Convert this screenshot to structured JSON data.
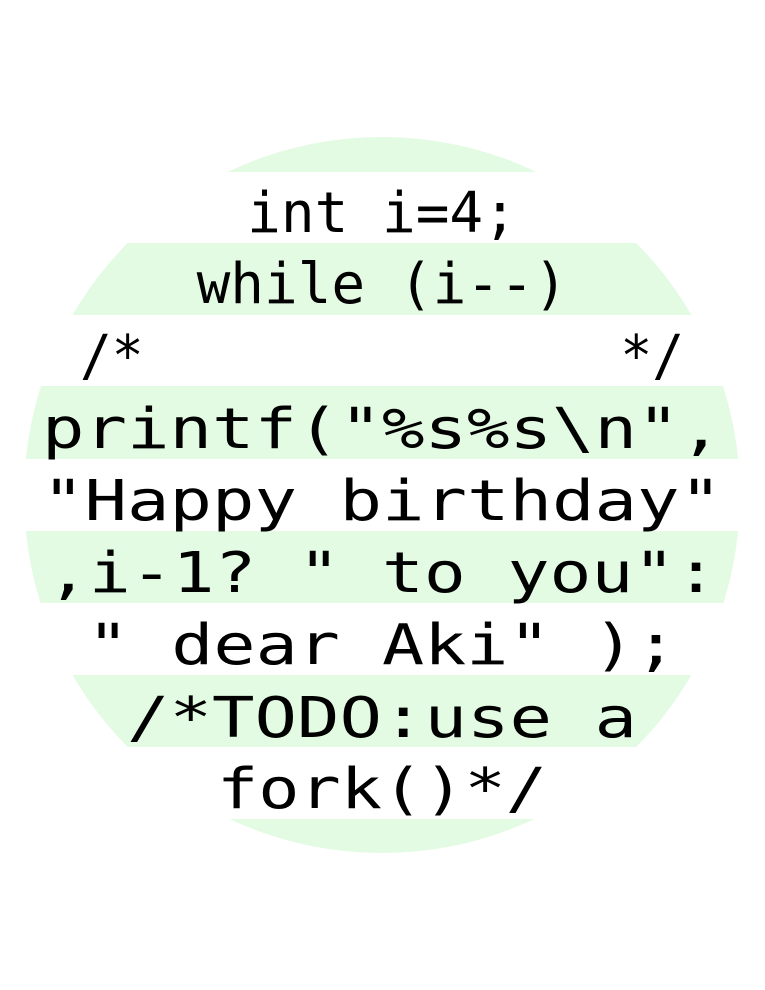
{
  "colors": {
    "background": "#ffffff",
    "stripe": "#e2fbe2",
    "text": "#000000"
  },
  "code_lines": [
    "int i=4;",
    "while (i--)",
    "/*               */",
    "printf(\"%s%s\\n\",",
    "\"Happy birthday\"",
    ",i-1? \" to you\":",
    "\" dear Aki\" );",
    "/*TODO:use a",
    "fork()*/"
  ]
}
